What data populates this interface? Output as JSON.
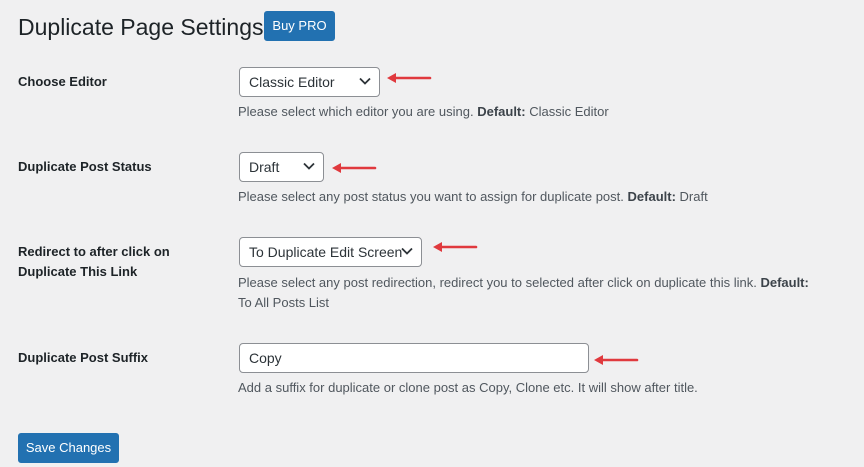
{
  "header": {
    "title": "Duplicate Page Settings",
    "buy_pro_label": "Buy PRO"
  },
  "fields": {
    "editor": {
      "label": "Choose Editor",
      "value": "Classic Editor",
      "desc": "Please select which editor you are using.",
      "default_label": "Default:",
      "default_value": "Classic Editor"
    },
    "status": {
      "label": "Duplicate Post Status",
      "value": "Draft",
      "desc": "Please select any post status you want to assign for duplicate post.",
      "default_label": "Default:",
      "default_value": "Draft"
    },
    "redirect": {
      "label_line1": "Redirect to after click on",
      "label_line2": "Duplicate This Link",
      "value": "To Duplicate Edit Screen",
      "desc": "Please select any post redirection, redirect you to selected after click on duplicate this link.",
      "default_label": "Default:",
      "default_value": "To All Posts List"
    },
    "suffix": {
      "label": "Duplicate Post Suffix",
      "value": "Copy",
      "desc": "Add a suffix for duplicate or clone post as Copy, Clone etc. It will show after title."
    }
  },
  "footer": {
    "save_label": "Save Changes"
  },
  "colors": {
    "primary_button": "#2271b1",
    "annotation_arrow": "#e0393e",
    "background": "#f0f0f1"
  },
  "icons": {
    "select_toggle": "chevron-down-icon",
    "annotation": "red-arrow-icon"
  }
}
